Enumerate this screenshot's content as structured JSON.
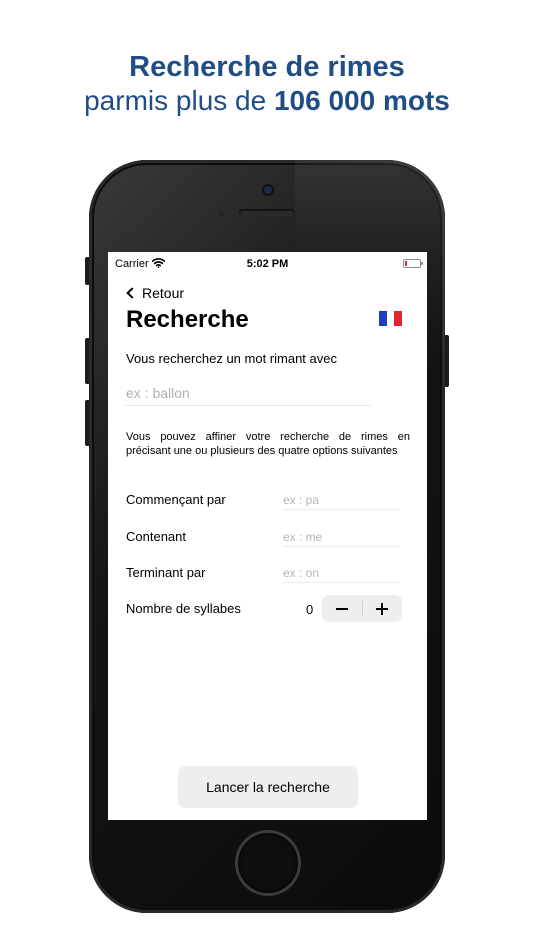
{
  "headline": {
    "line1": "Recherche de rimes",
    "line2_prefix": "parmis plus de ",
    "line2_bold": "106 000 mots"
  },
  "status_bar": {
    "carrier": "Carrier",
    "time": "5:02 PM",
    "battery_level_percent": 5
  },
  "nav": {
    "back_label": "Retour",
    "title": "Recherche",
    "flag_icon": "french-flag-icon"
  },
  "search": {
    "question": "Vous recherchez un mot rimant avec",
    "placeholder": "ex : ballon",
    "value": ""
  },
  "info_text": "Vous pouvez affiner votre recherche de rimes en précisant une ou plusieurs des quatre options suivantes",
  "options": {
    "starts_with": {
      "label": "Commençant par",
      "placeholder": "ex : pa"
    },
    "contains": {
      "label": "Contenant",
      "placeholder": "ex : me"
    },
    "ends_with": {
      "label": "Terminant par",
      "placeholder": "ex : on"
    },
    "syllables": {
      "label": "Nombre de syllabes",
      "value": "0"
    }
  },
  "launch_button": "Lancer la recherche",
  "colors": {
    "headline": "#1f4e86",
    "flag_blue": "#1f3dbe",
    "flag_red": "#e0262b",
    "stepper_bg": "#eeeef0",
    "button_bg": "#eeeeee"
  }
}
